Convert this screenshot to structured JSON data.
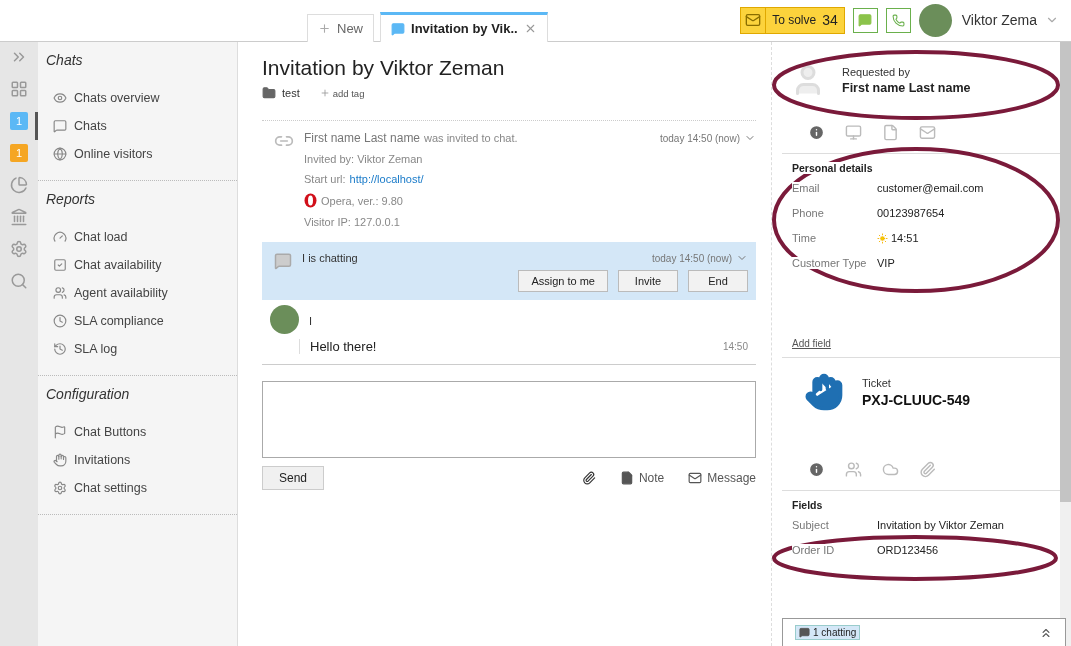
{
  "tabs": [
    {
      "kind": "new",
      "label": "New",
      "selected": false
    },
    {
      "kind": "chat",
      "label": "Invitation by Vik..",
      "selected": true
    }
  ],
  "toolbar": {
    "to_solve_label": "To solve",
    "to_solve_count": "34",
    "user_name": "Viktor Zema"
  },
  "rail": [
    {
      "kind": "expand"
    },
    {
      "kind": "dashboard"
    },
    {
      "kind": "badge",
      "text": "1",
      "color": "#5bb8f5"
    },
    {
      "kind": "badge",
      "text": "1",
      "color": "#f5a623"
    },
    {
      "kind": "reports"
    },
    {
      "kind": "bank"
    },
    {
      "kind": "settings"
    },
    {
      "kind": "search"
    }
  ],
  "nav": [
    {
      "title": "Chats",
      "items": [
        {
          "kind": "eye",
          "label": "Chats overview",
          "selected": false
        },
        {
          "kind": "chat",
          "label": "Chats",
          "selected": true
        },
        {
          "kind": "globe",
          "label": "Online visitors",
          "selected": false
        }
      ]
    },
    {
      "title": "Reports",
      "items": [
        {
          "kind": "gauge",
          "label": "Chat load",
          "selected": false
        },
        {
          "kind": "check",
          "label": "Chat availability",
          "selected": false
        },
        {
          "kind": "users",
          "label": "Agent availability",
          "selected": false
        },
        {
          "kind": "clock",
          "label": "SLA compliance",
          "selected": false
        },
        {
          "kind": "history",
          "label": "SLA log",
          "selected": false
        }
      ]
    },
    {
      "title": "Configuration",
      "items": [
        {
          "kind": "flag",
          "label": "Chat Buttons",
          "selected": false
        },
        {
          "kind": "hands",
          "label": "Invitations",
          "selected": false
        },
        {
          "kind": "gear",
          "label": "Chat settings",
          "selected": false
        }
      ]
    }
  ],
  "chat": {
    "title": "Invitation by Viktor Zeman",
    "tag": "test",
    "add_tag": "add tag",
    "event": {
      "name": "First name Last name",
      "text": "was invited to chat.",
      "time": "today 14:50 (now)",
      "invited_by": "Invited by: Viktor Zeman",
      "start_url_label": "Start url:",
      "start_url": "http://localhost/",
      "browser": "Opera, ver.: 9.80",
      "ip": "Visitor IP: 127.0.0.1"
    },
    "status": {
      "name": "I",
      "text": "is chatting",
      "time": "today 14:50 (now)",
      "buttons": [
        "Assign to me",
        "Invite",
        "End"
      ]
    },
    "message": {
      "author": "I",
      "text": "Hello there!",
      "time": "14:50"
    },
    "composer": {
      "send": "Send",
      "note": "Note",
      "message": "Message"
    }
  },
  "customer": {
    "requested_by": "Requested by",
    "name": "First name Last name",
    "tabs": [
      {
        "kind": "info",
        "selected": true
      },
      {
        "kind": "monitor",
        "selected": false
      },
      {
        "kind": "file",
        "selected": false
      },
      {
        "kind": "mail",
        "selected": false
      }
    ],
    "section": "Personal details",
    "fields": [
      {
        "label": "Email",
        "value": "customer@email.com",
        "kind": "text"
      },
      {
        "label": "Phone",
        "value": "00123987654",
        "kind": "text"
      },
      {
        "label": "Time",
        "value": "14:51",
        "kind": "time"
      },
      {
        "label": "Customer Type",
        "value": "VIP",
        "kind": "text"
      }
    ],
    "add_field": "Add field"
  },
  "ticket": {
    "label": "Ticket",
    "id": "PXJ-CLUUC-549",
    "tabs": [
      {
        "kind": "info",
        "selected": true
      },
      {
        "kind": "users",
        "selected": false
      },
      {
        "kind": "cloud",
        "selected": false
      },
      {
        "kind": "clip",
        "selected": false
      }
    ],
    "section": "Fields",
    "fields": [
      {
        "label": "Subject",
        "value": "Invitation by Viktor Zeman"
      },
      {
        "label": "Order ID",
        "value": "ORD123456"
      }
    ]
  },
  "footer": {
    "chatting": "1 chatting"
  }
}
